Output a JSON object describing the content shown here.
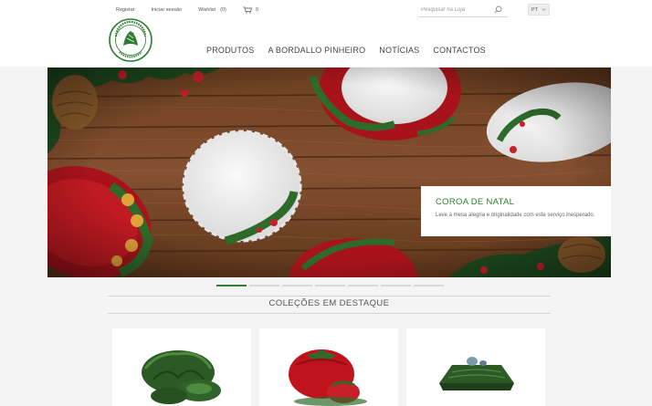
{
  "header": {
    "top_links": {
      "register": "Registar",
      "login": "Iniciar sessão",
      "wishlist": "Wishlist",
      "wishlist_count": "(0)",
      "cart_count": "0"
    },
    "search": {
      "placeholder": "Pesquisar na Loja"
    },
    "language": "PT",
    "logo_text": "BORDALLO PINHEIRO",
    "nav": [
      "PRODUTOS",
      "A BORDALLO PINHEIRO",
      "NOTÍCIAS",
      "CONTACTOS"
    ]
  },
  "banner": {
    "caption_title": "COROA DE NATAL",
    "caption_text": "Leve à mesa alegria e originalidade com este serviço inesperado.",
    "slide_count": 7,
    "active_slide": 1
  },
  "featured": {
    "title": "COLEÇÕES EM DESTAQUE",
    "cards": [
      {
        "icon": "cabbage-plates-image"
      },
      {
        "icon": "tomato-tureen-image"
      },
      {
        "icon": "cabbage-platter-image"
      }
    ]
  },
  "colors": {
    "brand_green": "#2e7d32",
    "wood": "#7a4a26",
    "plate_red": "#b5121b"
  }
}
